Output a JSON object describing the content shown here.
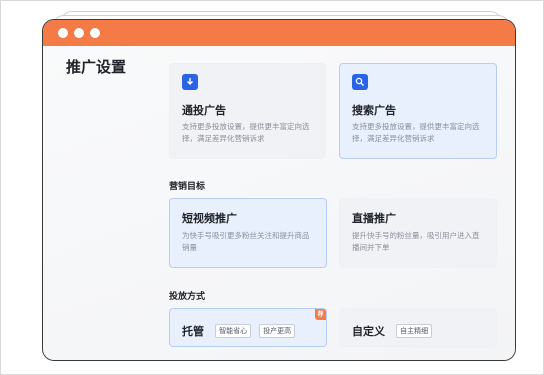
{
  "page": {
    "title": "推广设置"
  },
  "ad_types": [
    {
      "title": "通投广告",
      "desc": "支持更多投放设置，提供更丰富定向选择，满足差异化营销诉求",
      "icon": "download-doc-icon"
    },
    {
      "title": "搜索广告",
      "desc": "支持更多投放设置，提供更丰富定向选择，满足差异化营销诉求",
      "icon": "search-doc-icon"
    }
  ],
  "marketing": {
    "label": "营销目标",
    "options": [
      {
        "title": "短视频推广",
        "desc": "为快手号吸引更多粉丝关注和提升商品销量"
      },
      {
        "title": "直播推广",
        "desc": "提升快手号的粉丝量，吸引用户进入直播间并下单"
      }
    ]
  },
  "delivery": {
    "label": "投放方式",
    "options": [
      {
        "title": "托管",
        "tags": [
          "智能省心",
          "投产更高"
        ],
        "badge": "荐"
      },
      {
        "title": "自定义",
        "tags": [
          "自主精细"
        ]
      }
    ]
  },
  "colors": {
    "accent": "#f47b45",
    "primary": "#2b63e6",
    "selected_bg": "#e8f0fd"
  }
}
